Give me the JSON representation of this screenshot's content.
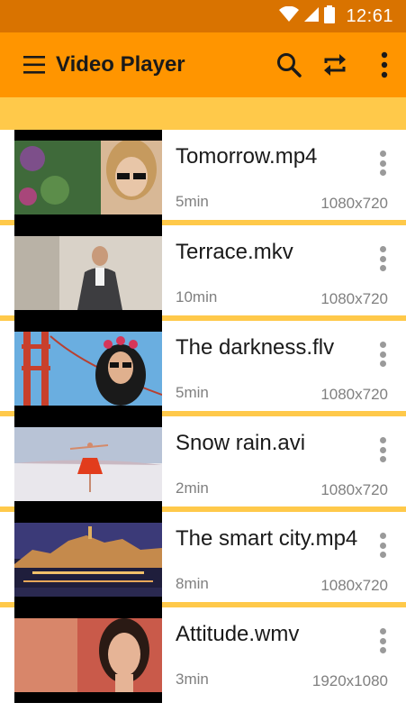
{
  "status_bar": {
    "time": "12:61"
  },
  "app_bar": {
    "title": "Video Player"
  },
  "videos": [
    {
      "title": "Tomorrow.mp4",
      "duration": "5min",
      "resolution": "1080x720"
    },
    {
      "title": "Terrace.mkv",
      "duration": "10min",
      "resolution": "1080x720"
    },
    {
      "title": "The darkness.flv",
      "duration": "5min",
      "resolution": "1080x720"
    },
    {
      "title": "Snow rain.avi",
      "duration": "2min",
      "resolution": "1080x720"
    },
    {
      "title": "The smart city.mp4",
      "duration": "8min",
      "resolution": "1080x720"
    },
    {
      "title": "Attitude.wmv",
      "duration": "3min",
      "resolution": "1920x1080"
    }
  ],
  "colors": {
    "status_bar": "#d97300",
    "app_bar": "#ff9500",
    "accent_strip": "#ffc94a"
  },
  "icons": [
    "wifi-icon",
    "signal-icon",
    "battery-icon",
    "menu-icon",
    "search-icon",
    "repeat-icon",
    "more-vert-icon"
  ]
}
